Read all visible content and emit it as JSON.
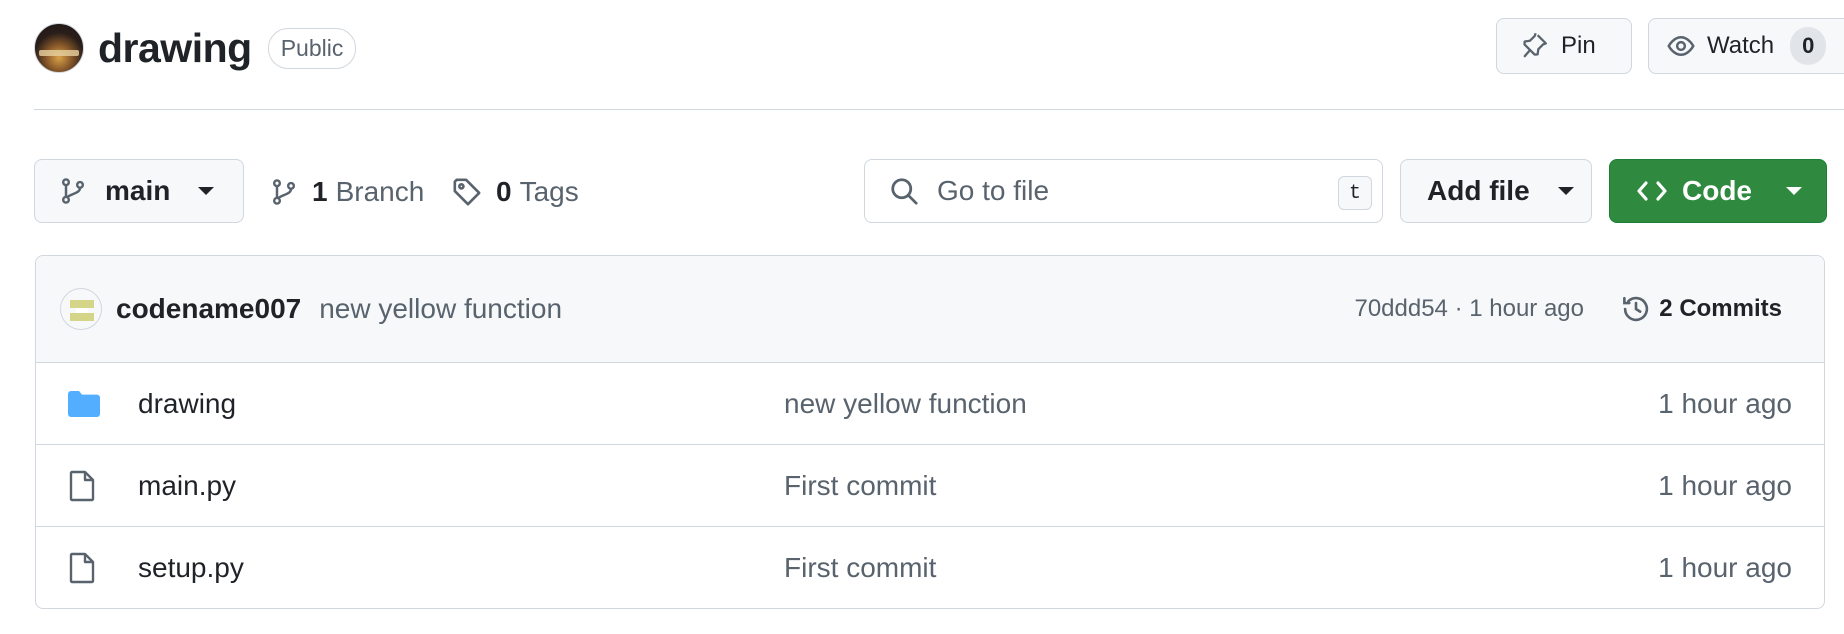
{
  "repo": {
    "name": "drawing",
    "visibility": "Public"
  },
  "header_actions": {
    "pin_label": "Pin",
    "watch_label": "Watch",
    "watch_count": "0"
  },
  "toolbar": {
    "branch": "main",
    "branch_count": "1",
    "branch_label": "Branch",
    "tag_count": "0",
    "tag_label": "Tags",
    "search_placeholder": "Go to file",
    "search_shortcut": "t",
    "add_file_label": "Add file",
    "code_label": "Code"
  },
  "latest_commit": {
    "author": "codename007",
    "message": "new yellow function",
    "meta": "70ddd54 · 1 hour ago",
    "commits_label": "2 Commits"
  },
  "files": [
    {
      "name": "drawing",
      "type": "folder",
      "message": "new yellow function",
      "age": "1 hour ago"
    },
    {
      "name": "main.py",
      "type": "file",
      "message": "First commit",
      "age": "1 hour ago"
    },
    {
      "name": "setup.py",
      "type": "file",
      "message": "First commit",
      "age": "1 hour ago"
    }
  ],
  "colors": {
    "primary_button": "#2f8a3f",
    "folder_icon": "#54aeff",
    "muted_text": "#59636e",
    "border": "#d0d7de"
  }
}
